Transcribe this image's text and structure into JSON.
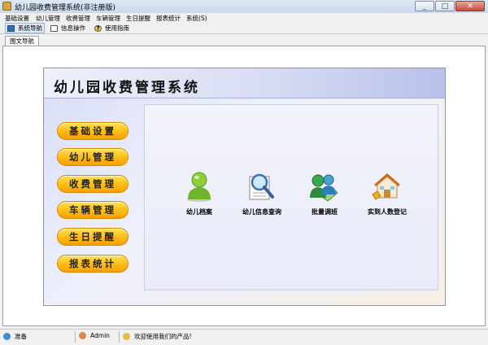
{
  "window": {
    "title": "幼儿园收费管理系统(非注册版)",
    "minimize": "_",
    "maximize": "□",
    "close": "✕"
  },
  "menu": [
    "基础设置",
    "幼儿管理",
    "收费管理",
    "车辆管理",
    "生日提醒",
    "报表统计",
    "系统(S)"
  ],
  "toolbar": {
    "nav": "系统导航",
    "info": "信息操作",
    "help": "使用指南"
  },
  "tab": {
    "label": "图文导航"
  },
  "panel": {
    "title": "幼儿园收费管理系统"
  },
  "nav_buttons": [
    "基础设置",
    "幼儿管理",
    "收费管理",
    "车辆管理",
    "生日提醒",
    "报表统计"
  ],
  "features": [
    {
      "label": "幼儿档案",
      "icon": "person-icon"
    },
    {
      "label": "幼儿信息查询",
      "icon": "magnifier-icon"
    },
    {
      "label": "批量调班",
      "icon": "group-icon"
    },
    {
      "label": "实到人数登记",
      "icon": "house-icon"
    }
  ],
  "status": {
    "ready": "准备",
    "user": "Admin",
    "welcome": "欢迎使用我们的产品!"
  },
  "colors": {
    "button": "#ffc21a",
    "panel_header": "#b9c0ea",
    "inner": "#eceef9"
  }
}
